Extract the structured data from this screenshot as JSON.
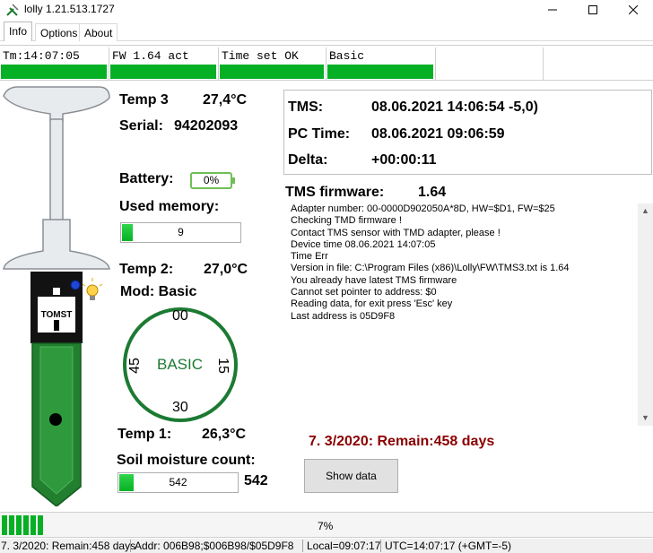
{
  "window": {
    "title": "lolly 1.21.513.1727",
    "app_icon": "lolly-app-icon",
    "minimize_icon": "minimize-icon",
    "maximize_icon": "maximize-icon",
    "close_icon": "close-icon"
  },
  "tabs": [
    {
      "label": "Info",
      "active": true
    },
    {
      "label": "Options",
      "active": false
    },
    {
      "label": "About",
      "active": false
    }
  ],
  "strip": [
    {
      "label": "Tm:14:07:05",
      "filled": true
    },
    {
      "label": "FW 1.64 act",
      "filled": true
    },
    {
      "label": "Time set OK",
      "filled": true
    },
    {
      "label": "Basic",
      "filled": true
    },
    {
      "label": "",
      "filled": false
    }
  ],
  "probe": {
    "brand": "TOMST",
    "indicator_icon": "lightbulb-icon",
    "led_icon": "blue-led-icon"
  },
  "left": {
    "temp3_label": "Temp 3",
    "temp3_value": "27,4°C",
    "serial_label": "Serial:",
    "serial_value": "94202093",
    "battery_label": "Battery:",
    "battery_value": "0%",
    "memory_label": "Used memory:",
    "memory_value": "9",
    "memory_fill": 0.09,
    "temp2_label": "Temp 2:",
    "temp2_value": "27,0°C",
    "mode_label": "Mod: Basic",
    "dial": {
      "top": "00",
      "right": "15",
      "bottom": "30",
      "left": "45",
      "center": "BASIC"
    },
    "temp1_label": "Temp 1:",
    "temp1_value": "26,3°C",
    "soil_label": "Soil moisture count:",
    "soil_value": "542",
    "soil_big": "542",
    "soil_fill": 0.12
  },
  "tms": {
    "tms_label": "TMS:",
    "tms_value": "08.06.2021 14:06:54 -5,0)",
    "pc_label": "PC Time:",
    "pc_value": "08.06.2021 09:06:59",
    "delta_label": "Delta:",
    "delta_value": "+00:00:11",
    "firmware_label": "TMS firmware:",
    "firmware_value": "1.64"
  },
  "log": [
    "Adapter number: 00-0000D902050A*8D, HW=$D1, FW=$25",
    "Checking TMD firmware !",
    "Contact TMS sensor with TMD adapter, please !",
    "Device time 08.06.2021 14:07:05",
    "Time Err",
    "Version in file: C:\\Program Files (x86)\\Lolly\\FW\\TMS3.txt is 1.64",
    "You already have latest TMS firmware",
    "Cannot set pointer to address: $0",
    "Reading data, for exit press 'Esc' key",
    "Last address is 05D9F8"
  ],
  "remain_text": "7. 3/2020: Remain:458 days",
  "show_button": "Show data",
  "progress": {
    "value": 0.07,
    "text": "7%"
  },
  "statusbar": {
    "remain": "7. 3/2020: Remain:458 days",
    "addr": "Addr: 006B98;$006B98/$05D9F8",
    "local": "Local=09:07:17",
    "utc": "UTC=14:07:17 (+GMT=-5)"
  },
  "colors": {
    "accent_green": "#06b025",
    "dark_green": "#1c7a33",
    "remain_red": "#8b0000"
  }
}
